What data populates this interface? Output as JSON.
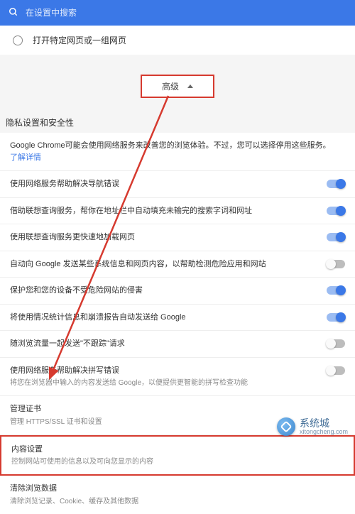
{
  "search": {
    "placeholder": "在设置中搜索"
  },
  "startup": {
    "option_label": "打开特定网页或一组网页"
  },
  "advanced": {
    "label": "高级"
  },
  "section": {
    "title": "隐私设置和安全性"
  },
  "intro": {
    "text": "Google Chrome可能会使用网络服务来改善您的浏览体验。不过，您可以选择停用这些服务。",
    "link": "了解详情"
  },
  "rows": [
    {
      "label": "使用网络服务帮助解决导航错误",
      "desc": "",
      "toggle": "on"
    },
    {
      "label": "借助联想查询服务，帮你在地址栏中自动填充未输完的搜索字词和网址",
      "desc": "",
      "toggle": "on"
    },
    {
      "label": "使用联想查询服务更快速地加载网页",
      "desc": "",
      "toggle": "on"
    },
    {
      "label": "自动向 Google 发送某些系统信息和网页内容，以帮助检测危险应用和网站",
      "desc": "",
      "toggle": "off"
    },
    {
      "label": "保护您和您的设备不受危险网站的侵害",
      "desc": "",
      "toggle": "on"
    },
    {
      "label": "将使用情况统计信息和崩溃报告自动发送给 Google",
      "desc": "",
      "toggle": "on"
    },
    {
      "label": "随浏览流量一起发送\"不跟踪\"请求",
      "desc": "",
      "toggle": "off"
    },
    {
      "label": "使用网络服务帮助解决拼写错误",
      "desc": "将您在浏览器中输入的内容发送给 Google，以便提供更智能的拼写检查功能",
      "toggle": "off"
    },
    {
      "label": "管理证书",
      "desc": "管理 HTTPS/SSL 证书和设置",
      "toggle": null
    },
    {
      "label": "内容设置",
      "desc": "控制网站可使用的信息以及可向您显示的内容",
      "toggle": null,
      "highlight": true
    },
    {
      "label": "清除浏览数据",
      "desc": "清除浏览记录、Cookie、缓存及其他数据",
      "toggle": null
    }
  ],
  "watermark": {
    "brand": "系统城",
    "url": "xitongcheng.com"
  },
  "colors": {
    "accent": "#3b78e7",
    "highlight": "#d63a2f"
  }
}
